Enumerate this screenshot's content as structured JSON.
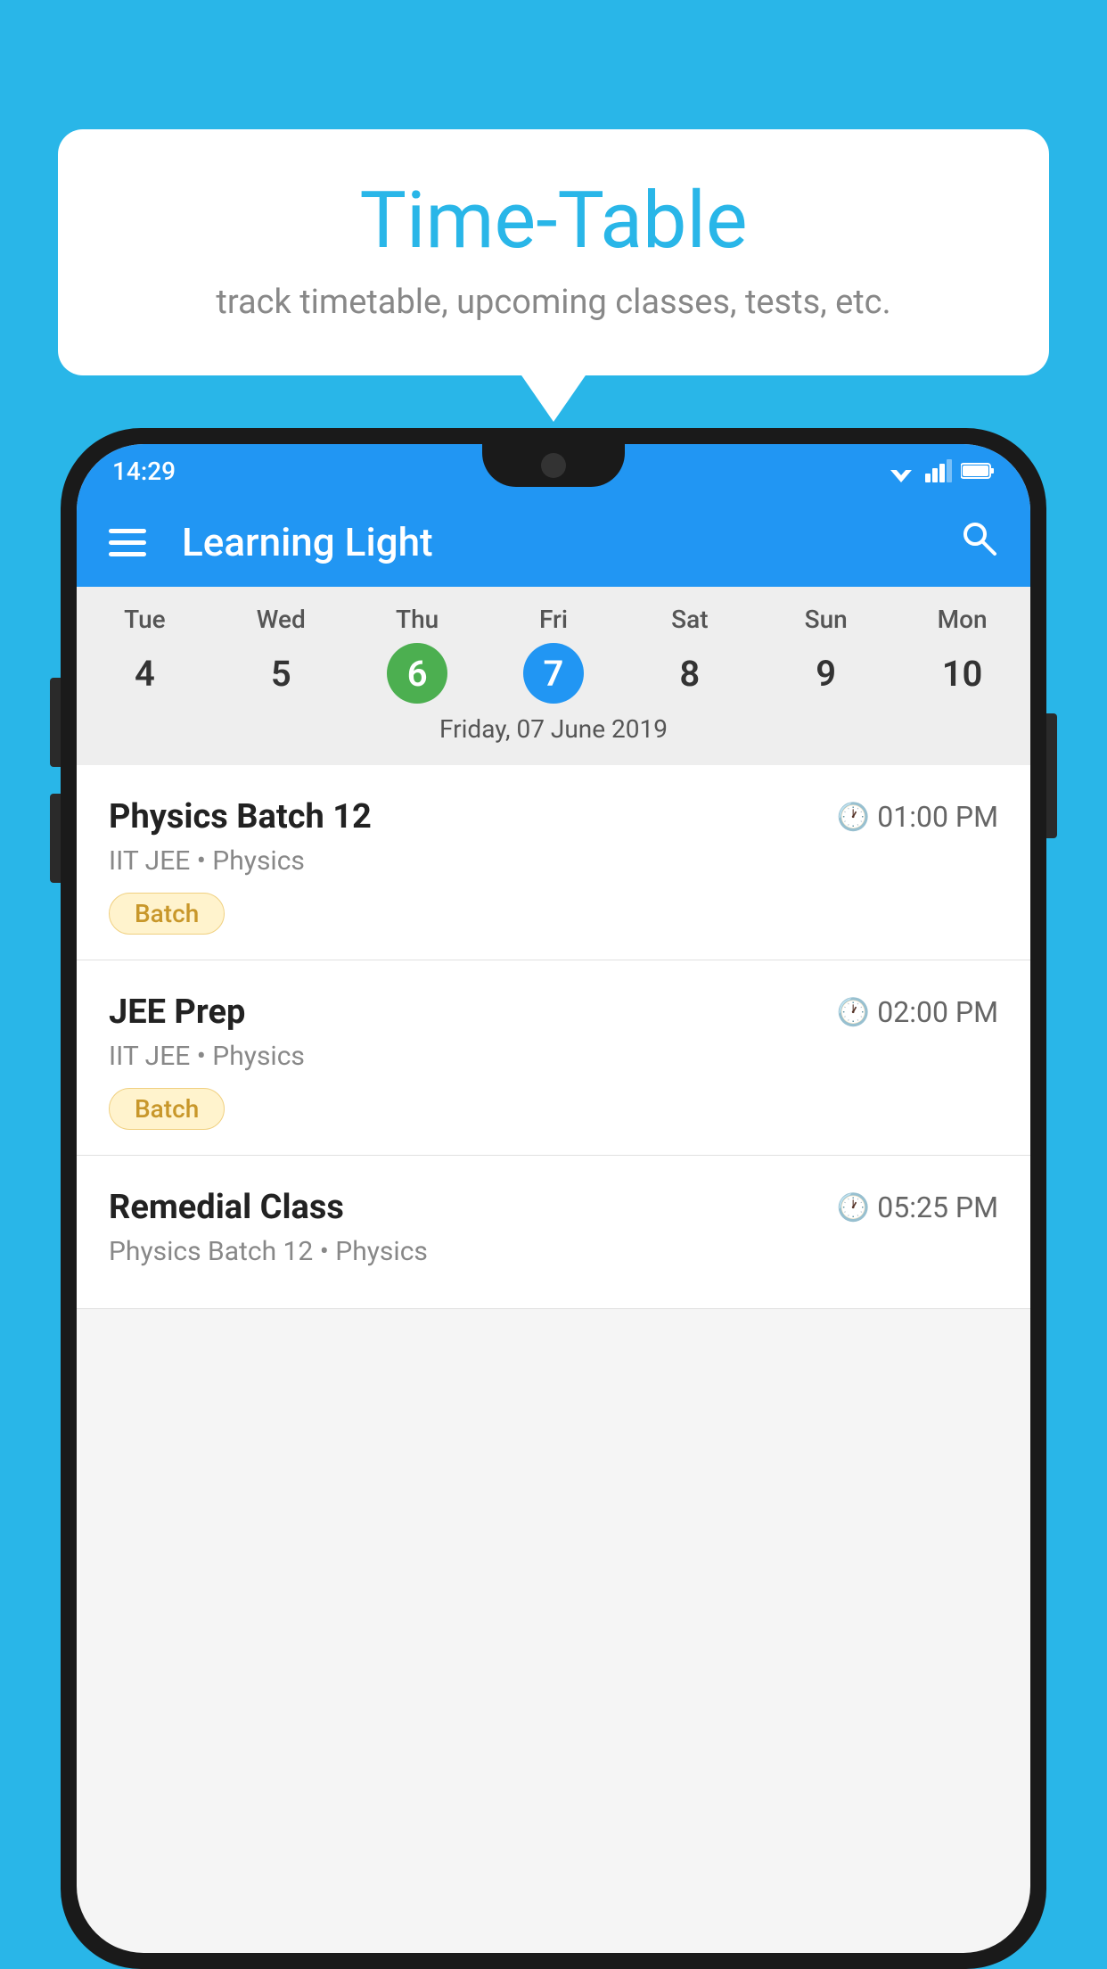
{
  "background_color": "#29B6E8",
  "bubble": {
    "title": "Time-Table",
    "subtitle": "track timetable, upcoming classes, tests, etc."
  },
  "phone": {
    "status_bar": {
      "time": "14:29"
    },
    "app_bar": {
      "title": "Learning Light"
    },
    "calendar": {
      "days": [
        "Tue",
        "Wed",
        "Thu",
        "Fri",
        "Sat",
        "Sun",
        "Mon"
      ],
      "dates": [
        "4",
        "5",
        "6",
        "7",
        "8",
        "9",
        "10"
      ],
      "today_index": 2,
      "selected_index": 3,
      "selected_label": "Friday, 07 June 2019"
    },
    "schedule": [
      {
        "title": "Physics Batch 12",
        "time": "01:00 PM",
        "sub": "IIT JEE • Physics",
        "badge": "Batch"
      },
      {
        "title": "JEE Prep",
        "time": "02:00 PM",
        "sub": "IIT JEE • Physics",
        "badge": "Batch"
      },
      {
        "title": "Remedial Class",
        "time": "05:25 PM",
        "sub": "Physics Batch 12 • Physics",
        "badge": null
      }
    ]
  },
  "labels": {
    "menu_icon": "☰",
    "search_icon": "🔍",
    "clock_icon": "🕐",
    "batch_badge": "Batch"
  }
}
